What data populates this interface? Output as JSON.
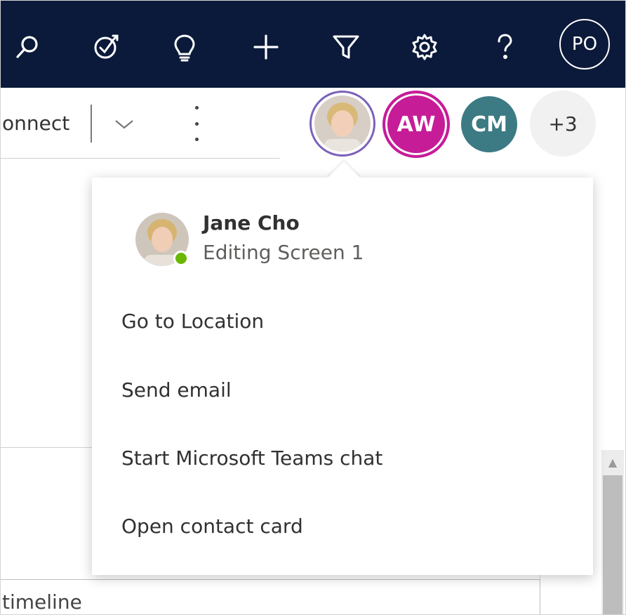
{
  "topbar": {
    "icons": [
      "search-icon",
      "target-icon",
      "lightbulb-icon",
      "plus-icon",
      "filter-icon",
      "settings-icon",
      "help-icon"
    ],
    "user_initials": "PO",
    "bg_color": "#0b1a3a"
  },
  "command_bar": {
    "connect_label": "onnect",
    "chevron_icon": "chevron-down-icon",
    "more_icon": "more-vertical-icon"
  },
  "collaborators": {
    "avatar1_initials": "AW",
    "avatar1_color": "#c61c97",
    "avatar2_initials": "CM",
    "avatar2_color": "#3c7a84",
    "overflow_label": "+3"
  },
  "contact_popup": {
    "name": "Jane Cho",
    "status": "Editing Screen 1",
    "presence_color": "#6bb700",
    "actions": [
      "Go to Location",
      "Send email",
      "Start Microsoft Teams chat",
      "Open contact card"
    ]
  },
  "background": {
    "timeline_label": "timeline"
  }
}
